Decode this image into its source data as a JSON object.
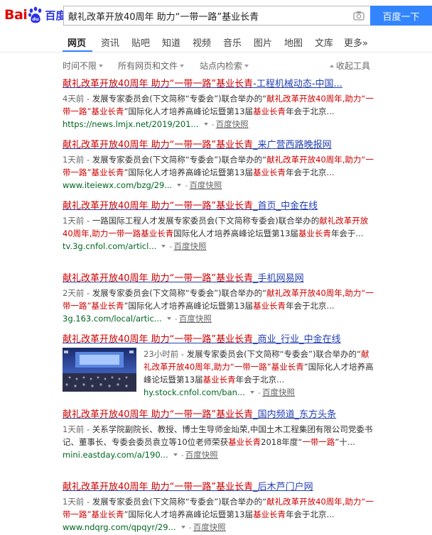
{
  "logo": {
    "left": "Bai",
    "right": "百度",
    "paw_char": "du"
  },
  "search": {
    "query": "献礼改革开放40周年 助力“一带一路”基业长青",
    "button": "百度一下"
  },
  "tabs": [
    "网页",
    "资讯",
    "贴吧",
    "知道",
    "视频",
    "音乐",
    "图片",
    "地图",
    "文库",
    "更多»"
  ],
  "tools": {
    "time": "时间不限",
    "file": "所有网页和文件",
    "site": "站点内检索",
    "collapse": "收起工具"
  },
  "colors": {
    "brand_red": "#e10602",
    "brand_blue": "#2932e1",
    "button_blue": "#3385ff",
    "link": "#2440b3",
    "highlight": "#c00",
    "url_green": "#006621"
  },
  "results": [
    {
      "title": [
        {
          "t": "献礼改革开放40周年 助力“一带一路”基业长青",
          "em": true
        },
        {
          "t": "-工程机械动态-中国...",
          "em": false
        }
      ],
      "abstract": [
        {
          "t": "4天前 - ",
          "g": true
        },
        {
          "t": "发展专家委员会(下文简称“专委会”)联合举办的“",
          "em": false
        },
        {
          "t": "献礼改革开放40周年,助力“一带一路”基业长青",
          "em": true
        },
        {
          "t": "”国际化人才培养高峰论坛暨第13届",
          "em": false
        },
        {
          "t": "基业长青",
          "em": true
        },
        {
          "t": "年会于北京...",
          "em": false
        }
      ],
      "url": "https://news.lmjx.net/2019/201...",
      "snap": "百度快照"
    },
    {
      "title": [
        {
          "t": "献礼改革开放40周年 助力“一带一路”基业长青",
          "em": true
        },
        {
          "t": "_来广营西路晚报网",
          "em": false
        }
      ],
      "abstract": [
        {
          "t": "1天前 - ",
          "g": true
        },
        {
          "t": "发展专家委员会(下文简称“专委会”)联合举办的“",
          "em": false
        },
        {
          "t": "献礼改革开放40周年,助力“一带一路”基业长青",
          "em": true
        },
        {
          "t": "”国际化人才培养高峰论坛暨第13届",
          "em": false
        },
        {
          "t": "基业长青",
          "em": true
        },
        {
          "t": "年会于北京...",
          "em": false
        }
      ],
      "url": "www.iteiewx.com/bzg/29...",
      "snap": "百度快照"
    },
    {
      "title": [
        {
          "t": "献礼改革开放40周年 助力“一带一路”基业长青",
          "em": true
        },
        {
          "t": "_首页_中金在线",
          "em": false
        }
      ],
      "abstract": [
        {
          "t": "1天前 - ",
          "g": true
        },
        {
          "t": "一路国际工程人才发展专家委员会(下文简称专委会)联合举办的",
          "em": false
        },
        {
          "t": "献礼改革开放40周年,助力一带一路基业长青",
          "em": true
        },
        {
          "t": "国际化人才培养高峰论坛暨第13届",
          "em": false
        },
        {
          "t": "基业长青",
          "em": true
        },
        {
          "t": "年会于...",
          "em": false
        }
      ],
      "url": "tv.3g.cnfol.com/articl...",
      "snap": "百度快照"
    },
    {
      "title": [
        {
          "t": "献礼改革开放40周年 助力“一带一路”基业长青",
          "em": true
        },
        {
          "t": "_手机网易网",
          "em": false
        }
      ],
      "abstract": [
        {
          "t": "2天前 - ",
          "g": true
        },
        {
          "t": "发展专家委员会(下文简称“专委会”)联合举办的“",
          "em": false
        },
        {
          "t": "献礼改革开放40周年,助力“一带一路”基业长青",
          "em": true
        },
        {
          "t": "”国际化人才培养高峰论坛暨第13届",
          "em": false
        },
        {
          "t": "基业长青",
          "em": true
        },
        {
          "t": "年会于北京...",
          "em": false
        }
      ],
      "url": "3g.163.com/local/artic...",
      "snap": "百度快照"
    },
    {
      "title": [
        {
          "t": "献礼改革开放40周年 助力“一带一路”基业长青",
          "em": true
        },
        {
          "t": "_商业_行业_中金在线",
          "em": false
        }
      ],
      "abstract": [
        {
          "t": "23小时前 - ",
          "g": true
        },
        {
          "t": "发展专家委员会(下文简称“专委会”)联合举办的“",
          "em": false
        },
        {
          "t": "献礼改革开放40周年,助力“一带一路”基业长青",
          "em": true
        },
        {
          "t": "”国际化人才培养高峰论坛暨第13届",
          "em": false
        },
        {
          "t": "基业长青",
          "em": true
        },
        {
          "t": "年会于北京...",
          "em": false
        }
      ],
      "url": "hy.stock.cnfol.com/ban...",
      "snap": "百度快照"
    },
    {
      "title": [
        {
          "t": "献礼改革开放40周年 助力“一带一路”基业长青",
          "em": true
        },
        {
          "t": "_国内频道_东方头条",
          "em": false
        }
      ],
      "abstract": [
        {
          "t": "1天前 - ",
          "g": true
        },
        {
          "t": "关系学院副院长、教授、博士生导师金灿荣,中国土木工程集团有限公司党委书记、董事长、专委会委员袁立等10位老师荣获",
          "em": false
        },
        {
          "t": "基业长青",
          "em": true
        },
        {
          "t": "2018年度“",
          "em": false
        },
        {
          "t": "一带一路",
          "em": true
        },
        {
          "t": "”十...",
          "em": false
        }
      ],
      "url": "mini.eastday.com/a/190...",
      "snap": "百度快照"
    },
    {
      "title": [
        {
          "t": "献礼改革开放40周年 助力“一带一路”基业长青",
          "em": true
        },
        {
          "t": "_后木芦门户网",
          "em": false
        }
      ],
      "abstract": [
        {
          "t": "1天前 - ",
          "g": true
        },
        {
          "t": "发展专家委员会(下文简称“专委会”)联合举办的“",
          "em": false
        },
        {
          "t": "献礼改革开放40周年,助力“一带一路”基业长青",
          "em": true
        },
        {
          "t": "”国际化人才培养高峰论坛暨第13届",
          "em": false
        },
        {
          "t": "基业长青",
          "em": true
        },
        {
          "t": "年会于北京...",
          "em": false
        }
      ],
      "url": "www.ndqrg.com/qpqyr/29...",
      "snap": "百度快照"
    }
  ]
}
